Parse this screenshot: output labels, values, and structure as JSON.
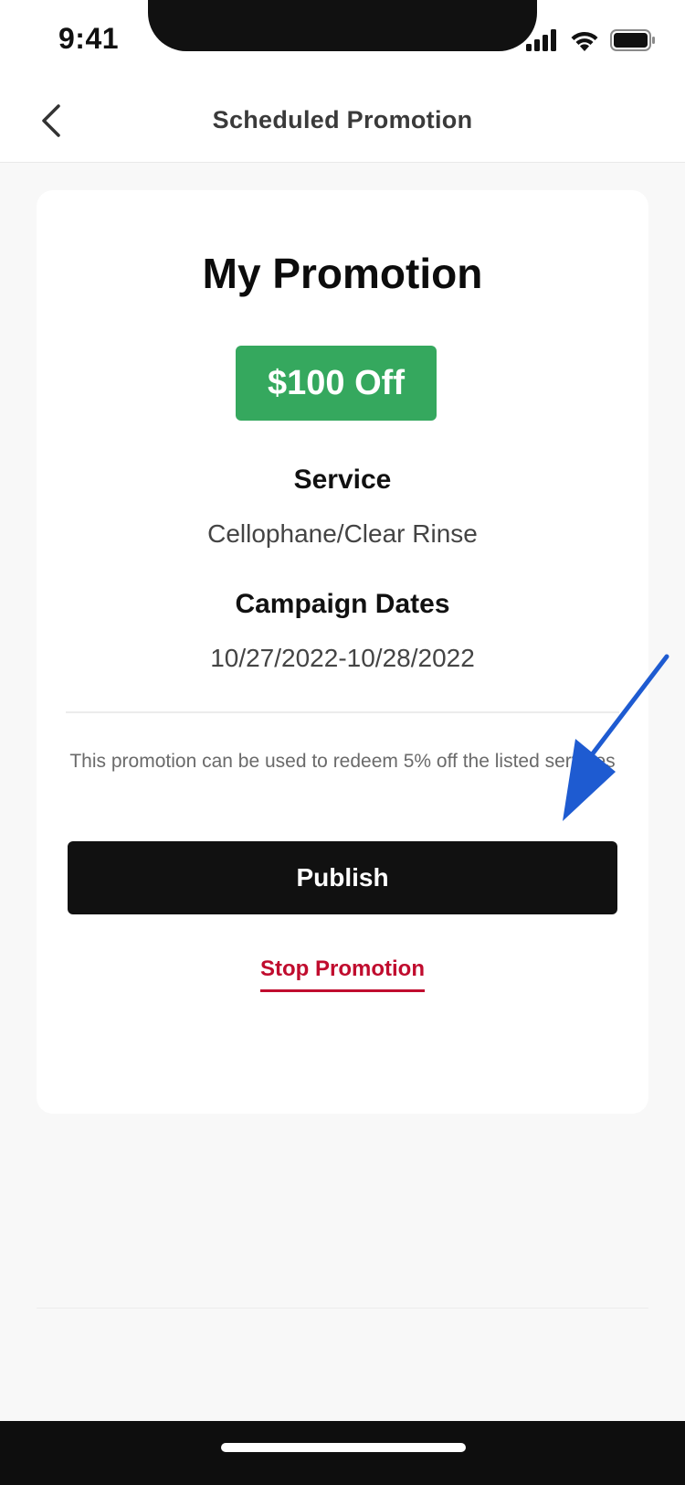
{
  "status_bar": {
    "time": "9:41",
    "icons": [
      "signal-icon",
      "wifi-icon",
      "battery-icon"
    ]
  },
  "header": {
    "title": "Scheduled Promotion",
    "back_icon": "chevron-left-icon"
  },
  "promotion": {
    "title": "My Promotion",
    "discount_badge": "$100 Off",
    "service_label": "Service",
    "service_value": "Cellophane/Clear Rinse",
    "dates_label": "Campaign Dates",
    "dates_value": "10/27/2022-10/28/2022",
    "description": "This promotion can be used to redeem 5% off the listed services"
  },
  "actions": {
    "publish_label": "Publish",
    "stop_label": "Stop Promotion"
  },
  "colors": {
    "badge": "#35a85e",
    "primary_button": "#111111",
    "danger": "#c00c2e",
    "annotation_arrow": "#1e5bd1"
  }
}
